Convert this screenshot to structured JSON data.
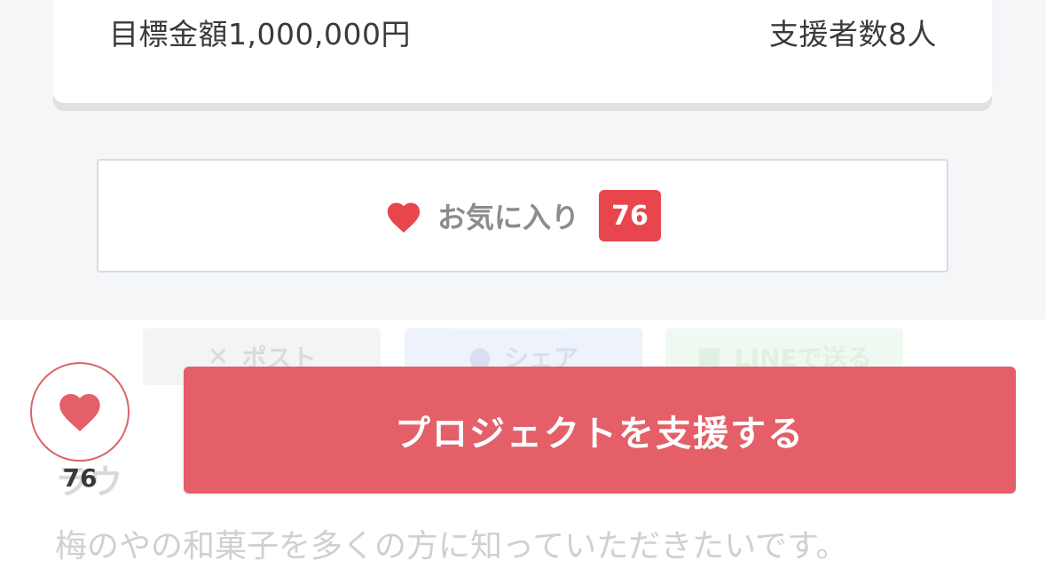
{
  "summary": {
    "target_amount": "目標金額1,000,000円",
    "supporter_count": "支援者数8人"
  },
  "favorite": {
    "label": "お気に入り",
    "count": "76",
    "icon": "heart-icon",
    "color": "#e8464c"
  },
  "share": {
    "x_label": "ポスト",
    "x_icon": "x-icon",
    "facebook_label": "シェア",
    "facebook_icon": "facebook-icon",
    "line_label": "LINEで送る",
    "line_icon": "line-icon"
  },
  "content": {
    "heading_partial": "ラウ",
    "body_text": "梅のやの和菓子を多くの方に知っていただきたいです。"
  },
  "sticky_bar": {
    "heart_count": "76",
    "heart_icon": "heart-icon",
    "support_button_label": "プロジェクトを支援する",
    "accent_color": "#e45f68"
  }
}
